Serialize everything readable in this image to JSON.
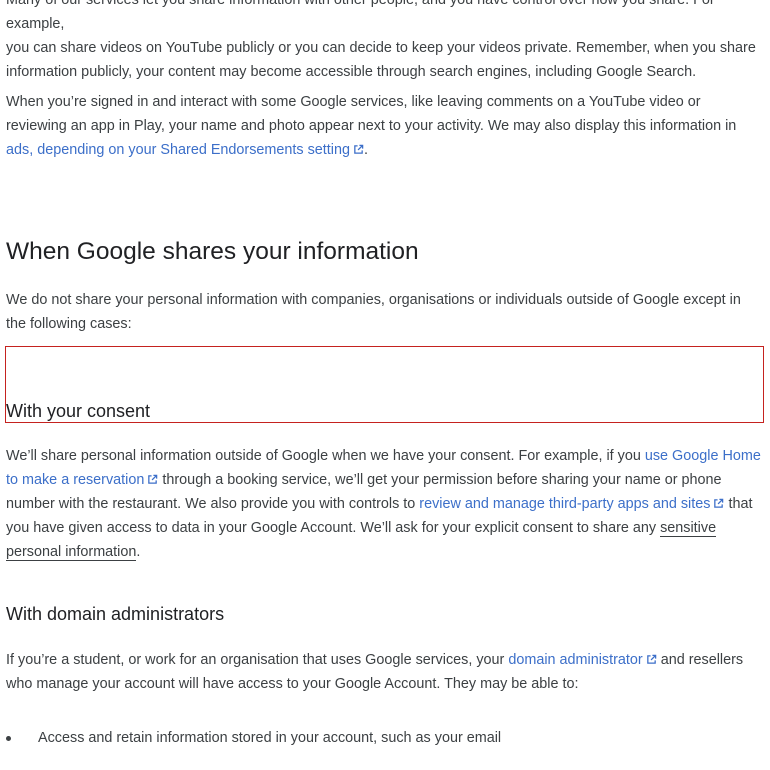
{
  "intro": {
    "p1_line1": "Many of our services let you share information with other people, and you have control over how you share. For example,",
    "p1_rest": "you can share videos on YouTube publicly or you can decide to keep your videos private. Remember, when you share information publicly, your content may become accessible through search engines, including Google Search.",
    "p2_text": "When you’re signed in and interact with some Google services, like leaving comments on a YouTube video or reviewing an app in Play, your name and photo appear next to your activity. We may also display this information in ",
    "p2_link": "ads, depending on your Shared Endorsements setting",
    "p2_end": "."
  },
  "sharing": {
    "heading": "When Google shares your information",
    "intro": "We do not share your personal information with companies, organisations or individuals outside of Google except in the following cases:"
  },
  "consent": {
    "heading": "With your consent",
    "t1": "We’ll share personal information outside of Google when we have your consent. For example, if you ",
    "link1": "use Google Home to make a reservation",
    "t2": " through a booking service, we’ll get your permission before sharing your name or phone number with the restaurant. We also provide you with controls to ",
    "link2": "review and manage third-party apps and sites",
    "t3": " that you have given access to data in your Google Account. We’ll ask for your explicit consent to share any ",
    "link3": "sensitive personal information",
    "t4": "."
  },
  "domain": {
    "heading": "With domain administrators",
    "t1": "If you’re a student, or work for an organisation that uses Google services, your ",
    "link1": "domain administrator",
    "t2": " and resellers who manage your account will have access to your Google Account. They may be able to:",
    "items": [
      "Access and retain information stored in your account, such as your email"
    ]
  },
  "colors": {
    "link": "#3c6fc9",
    "text": "#3c4043",
    "highlight_border": "#c5221f"
  },
  "icons": {
    "external_link": "external-link-icon"
  }
}
